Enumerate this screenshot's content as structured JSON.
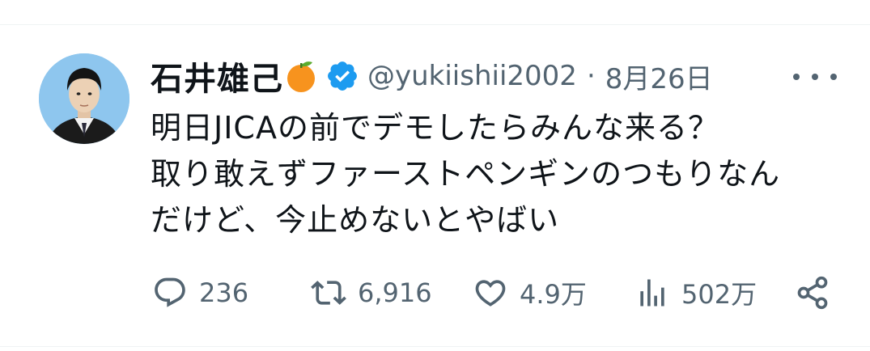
{
  "author": {
    "display_name": "石井雄己",
    "handle": "@yukiishii2002",
    "verified_icon": "verified-badge-icon",
    "name_emoji": "orange-emoji"
  },
  "meta": {
    "separator": "·",
    "date": "8月26日"
  },
  "tweet": {
    "text": "明日JICAの前でデモしたらみんな来る？\n取り敢えずファーストペンギンのつもりなん\nだけど、今止めないとやばい"
  },
  "actions": {
    "replies": "236",
    "retweets": "6,916",
    "likes": "4.9万",
    "views": "502万"
  },
  "colors": {
    "text_primary": "#0f1419",
    "text_secondary": "#536471",
    "verified_blue": "#1d9bf0",
    "divider": "#eff3f4",
    "emoji_orange": "#f7931e"
  }
}
